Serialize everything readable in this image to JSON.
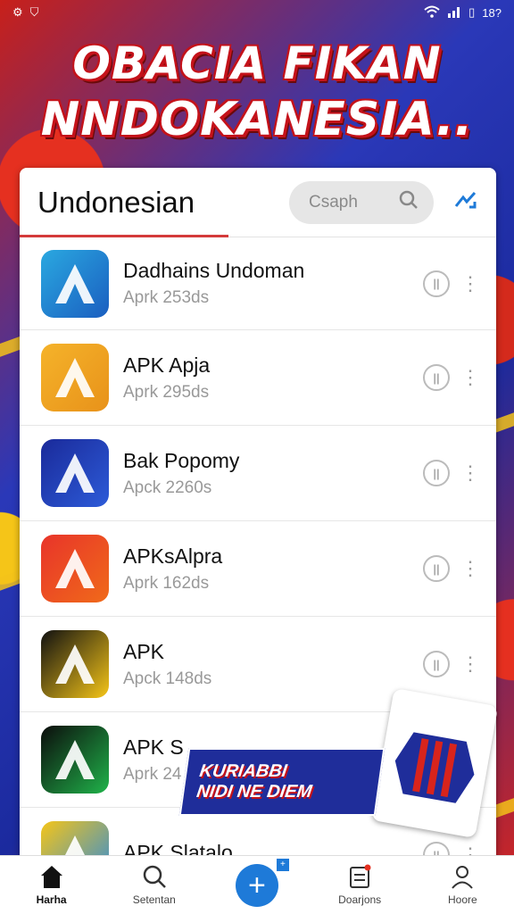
{
  "status_bar": {
    "battery": "18?"
  },
  "banner": {
    "line1": "OBACIA FIKAN",
    "line2": "NNDOKANESIA.."
  },
  "header": {
    "title": "Undonesian",
    "search_placeholder": "Csaph"
  },
  "apps": [
    {
      "name": "Dadhains Undoman",
      "size": "Aprk 253ds",
      "icon": "a-logo-icon",
      "icon_colors": [
        "#2aa8e0",
        "#1a5ec0"
      ]
    },
    {
      "name": "APK Apja",
      "size": "Aprk 295ds",
      "icon": "a-chevron-icon",
      "icon_colors": [
        "#f5b32a",
        "#e8921a"
      ]
    },
    {
      "name": "Bak Popomy",
      "size": "Apck 2260s",
      "icon": "a-blue-icon",
      "icon_colors": [
        "#1a2a9a",
        "#2d5bd8"
      ]
    },
    {
      "name": "APKsAlpra",
      "size": "Aprk 162ds",
      "icon": "a-red-icon",
      "icon_colors": [
        "#e8342a",
        "#f06a1a"
      ]
    },
    {
      "name": "APK",
      "size": "Apck 148ds",
      "icon": "a-drive-icon",
      "icon_colors": [
        "#111",
        "#f5c518"
      ]
    },
    {
      "name": "APK S",
      "size": "Aprk 24",
      "icon": "a-dark-icon",
      "icon_colors": [
        "#0c0c0c",
        "#20b34a"
      ]
    },
    {
      "name": "APK Slatalo",
      "size": "",
      "icon": "a-yellow-icon",
      "icon_colors": [
        "#f5c518",
        "#2a8ae0"
      ]
    }
  ],
  "promo": {
    "line1": "KURIABBI",
    "line2": "NIDI NE DIEM"
  },
  "bottom_nav": [
    {
      "label": "Harha",
      "icon": "home-icon"
    },
    {
      "label": "Setentan",
      "icon": "search-icon"
    },
    {
      "label": "",
      "icon": "plus-icon"
    },
    {
      "label": "Doarjons",
      "icon": "documents-icon"
    },
    {
      "label": "Hoore",
      "icon": "profile-icon"
    }
  ]
}
